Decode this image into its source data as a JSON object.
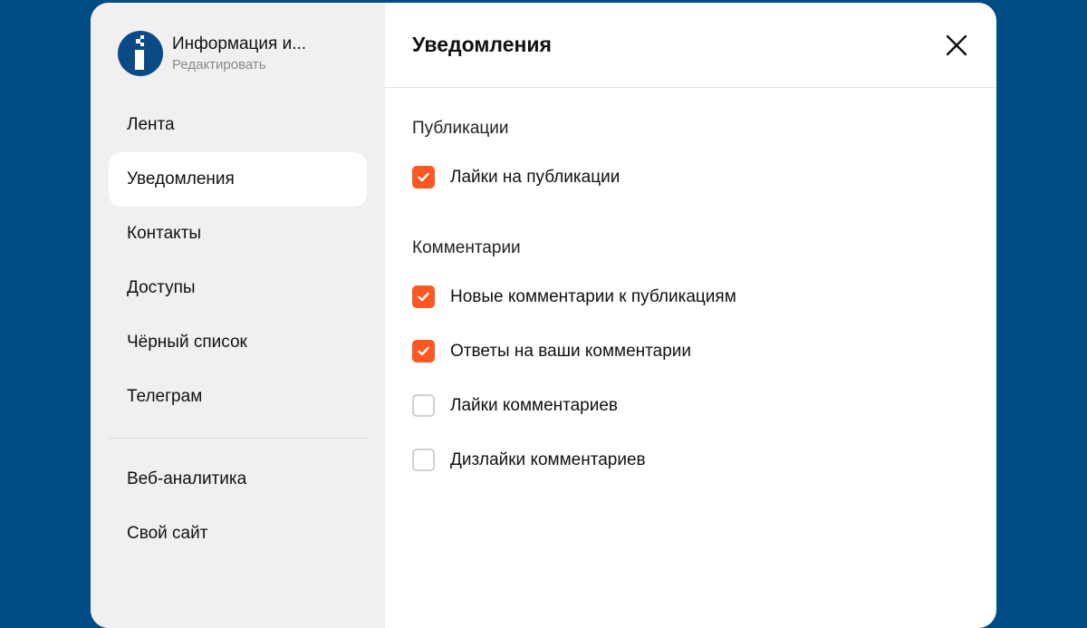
{
  "profile": {
    "name": "Информация и...",
    "edit_label": "Редактировать"
  },
  "sidebar": {
    "items": [
      {
        "label": "Лента"
      },
      {
        "label": "Уведомления"
      },
      {
        "label": "Контакты"
      },
      {
        "label": "Доступы"
      },
      {
        "label": "Чёрный список"
      },
      {
        "label": "Телеграм"
      }
    ],
    "extra_items": [
      {
        "label": "Веб-аналитика"
      },
      {
        "label": "Свой сайт"
      }
    ],
    "active_index": 1
  },
  "header": {
    "title": "Уведомления",
    "close_icon": "close-icon"
  },
  "sections": {
    "publications": {
      "title": "Публикации",
      "options": [
        {
          "label": "Лайки на публикации",
          "checked": true
        }
      ]
    },
    "comments": {
      "title": "Комментарии",
      "options": [
        {
          "label": "Новые комментарии к публикациям",
          "checked": true
        },
        {
          "label": "Ответы на ваши комментарии",
          "checked": true
        },
        {
          "label": "Лайки комментариев",
          "checked": false
        },
        {
          "label": "Дизлайки комментариев",
          "checked": false
        }
      ]
    }
  },
  "colors": {
    "background": "#004b83",
    "accent": "#ff5722",
    "sidebar_bg": "#f0f0f0",
    "avatar_bg": "#0b4a86"
  }
}
